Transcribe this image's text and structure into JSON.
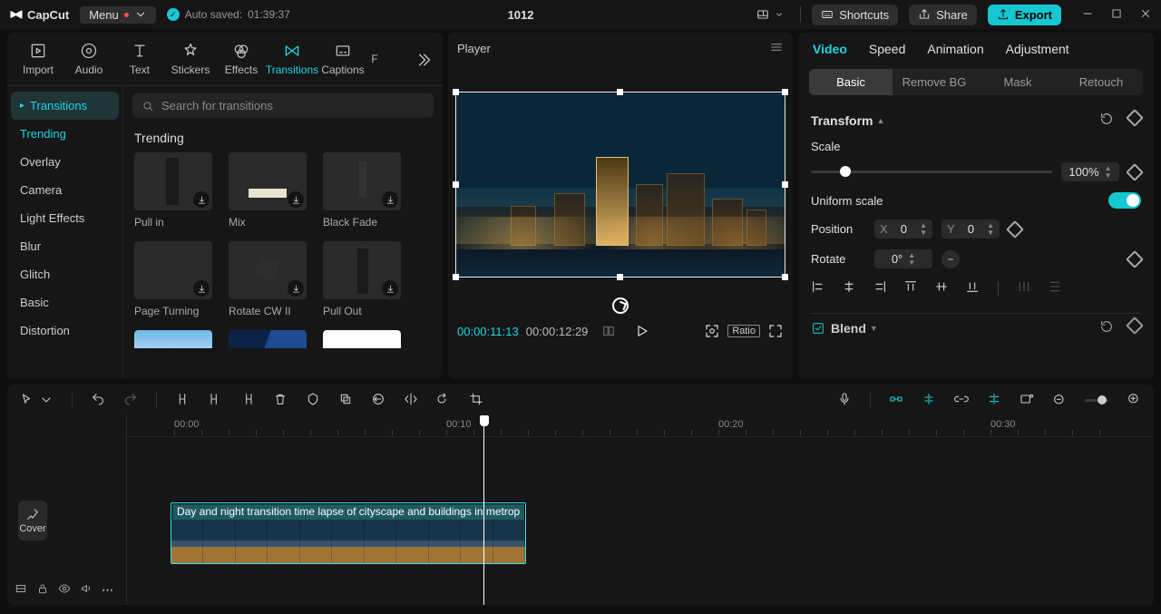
{
  "app": {
    "name": "CapCut",
    "menu": "Menu",
    "autosave_label": "Auto saved:",
    "autosave_time": "01:39:37",
    "project_title": "1012"
  },
  "titlebar": {
    "shortcuts": "Shortcuts",
    "share": "Share",
    "export": "Export"
  },
  "media_tabs": [
    "Import",
    "Audio",
    "Text",
    "Stickers",
    "Effects",
    "Transitions",
    "Captions",
    "F"
  ],
  "media_tabs_active": 5,
  "sidebar": {
    "tab": "Transitions",
    "items": [
      "Trending",
      "Overlay",
      "Camera",
      "Light Effects",
      "Blur",
      "Glitch",
      "Basic",
      "Distortion"
    ],
    "selected": 0
  },
  "search": {
    "placeholder": "Search for transitions"
  },
  "grid": {
    "title": "Trending",
    "items": [
      "Pull in",
      "Mix",
      "Black Fade",
      "Page Turning",
      "Rotate CW II",
      "Pull Out"
    ]
  },
  "player": {
    "title": "Player",
    "current": "00:00:11:13",
    "duration": "00:00:12:29",
    "ratio": "Ratio"
  },
  "inspector": {
    "tabs": [
      "Video",
      "Speed",
      "Animation",
      "Adjustment"
    ],
    "subtabs": [
      "Basic",
      "Remove BG",
      "Mask",
      "Retouch"
    ],
    "transform": "Transform",
    "scale_label": "Scale",
    "scale_value": "100%",
    "uniform": "Uniform scale",
    "position": "Position",
    "x_label": "X",
    "x_val": "0",
    "y_label": "Y",
    "y_val": "0",
    "rotate": "Rotate",
    "rotate_val": "0°",
    "blend": "Blend"
  },
  "ruler": {
    "marks": [
      "00:00",
      "00:10",
      "00:20",
      "00:30"
    ]
  },
  "clip": {
    "title": "Day and night transition time lapse of cityscape and buildings in metrop"
  },
  "cover": "Cover"
}
